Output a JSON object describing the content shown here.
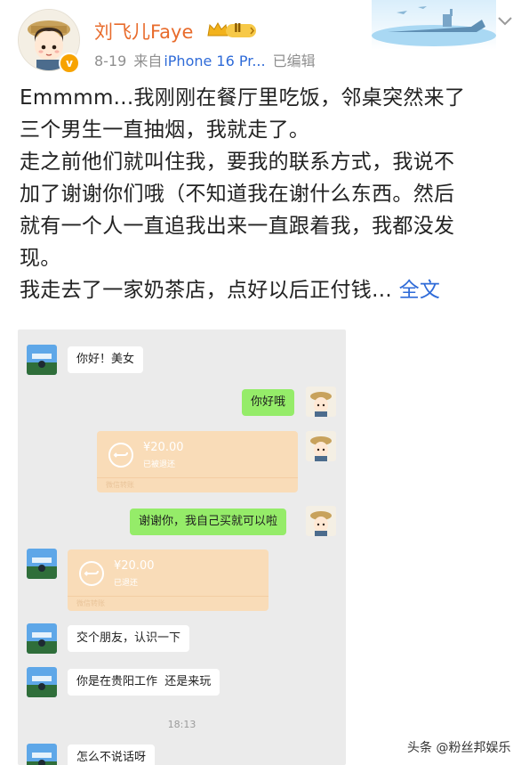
{
  "user": {
    "name": "刘飞儿Faye",
    "vip_level": "Ⅱ",
    "verified_mark": "v",
    "date": "8-19",
    "source": "来自",
    "device": "iPhone 16 Pr...",
    "edited": "已编辑"
  },
  "post": {
    "line1": "Emmmm...我刚刚在餐厅里吃饭，邻桌突然来了",
    "line2": "三个男生一直抽烟，我就走了。",
    "line3": "走之前他们就叫住我，要我的联系方式，我说不",
    "line4": "加了谢谢你们哦（不知道我在谢什么东西。然后",
    "line5": "就有一个人一直追我出来一直跟着我，我都没发",
    "line6": "现。",
    "line7": "我走去了一家奶茶店，点好以后正付钱...",
    "full_text_link": "全文"
  },
  "chat": {
    "messages": [
      {
        "text": "你好！美女"
      },
      {
        "text": "你好哦"
      },
      {
        "text": "谢谢你，我自己买就可以啦"
      },
      {
        "text": "交个朋友，认识一下"
      },
      {
        "text": "你是在贵阳工作  还是来玩"
      },
      {
        "text": "怎么不说话呀"
      }
    ],
    "transfer_sent": {
      "amount": "¥20.00",
      "status": "已被退还",
      "footer": "微信转账"
    },
    "transfer_received": {
      "amount": "¥20.00",
      "status": "已退还",
      "footer": "微信转账"
    },
    "timestamp": "18:13"
  },
  "watermark": "头条 @粉丝邦娱乐",
  "colors": {
    "username": "#e86b2b",
    "link": "#2f6bd8",
    "bubble_green": "#95ec69",
    "transfer": "#f9dcb8",
    "chat_bg": "#ebebeb"
  },
  "icons": [
    "avatar",
    "vip-crown-icon",
    "chevron-down-icon",
    "transfer-return-icon"
  ]
}
